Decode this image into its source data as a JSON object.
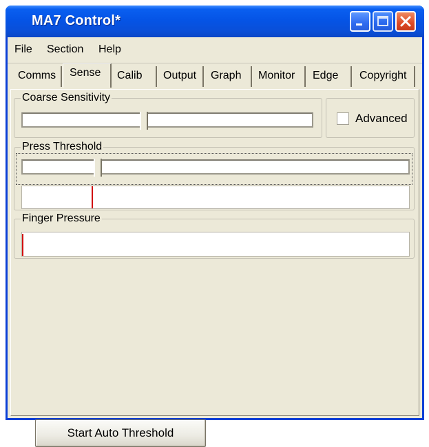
{
  "window": {
    "title": "MA7 Control*"
  },
  "menu": {
    "items": [
      "File",
      "Section",
      "Help"
    ]
  },
  "tabs": {
    "items": [
      "Comms",
      "Sense",
      "Calib",
      "Output",
      "Graph",
      "Monitor",
      "Edge",
      "Copyright"
    ],
    "active": "Sense"
  },
  "coarse": {
    "legend": "Coarse Sensitivity",
    "level": 0.42
  },
  "advanced": {
    "label": "Advanced",
    "checked": false
  },
  "press": {
    "legend": "Press Threshold",
    "slider_level": 0.19,
    "marker_level": 0.18
  },
  "finger": {
    "legend": "Finger Pressure",
    "marker_level": 0.0
  },
  "auto_button": {
    "label": "Start Auto Threshold"
  },
  "colors": {
    "titlebar": "#0554e6",
    "marker": "#d01010",
    "face": "#ece9d8"
  }
}
